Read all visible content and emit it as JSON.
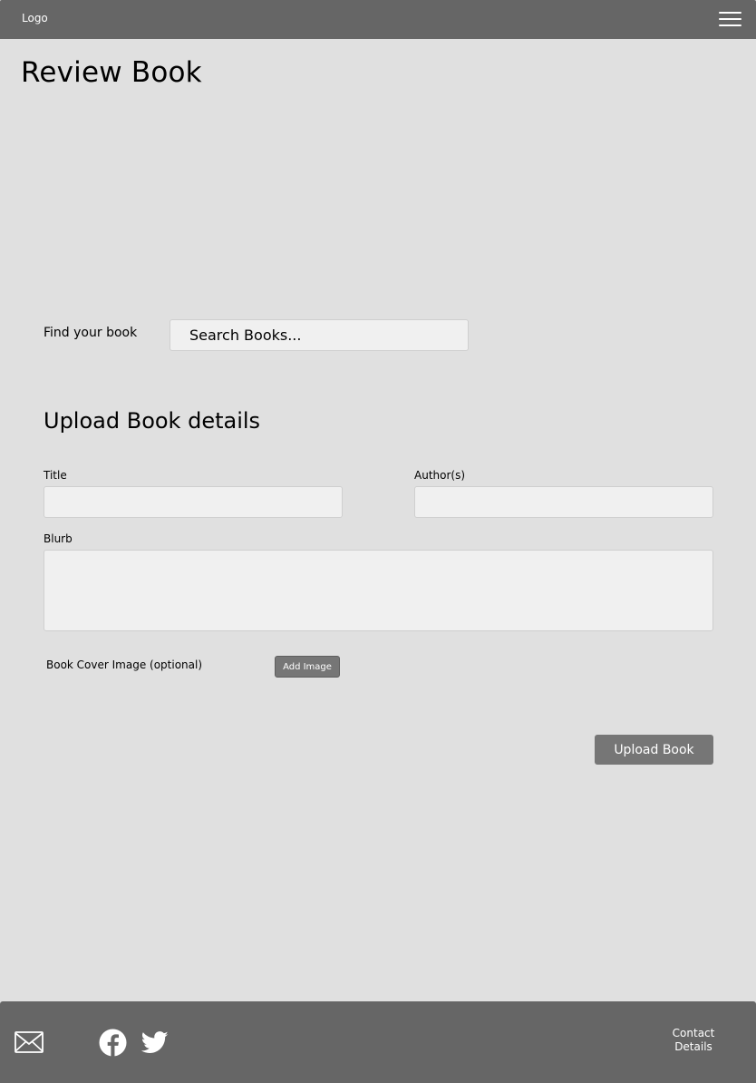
{
  "header": {
    "logo": "Logo",
    "menu_icon": "hamburger-menu-icon"
  },
  "page": {
    "title": "Review Book"
  },
  "find": {
    "label": "Find your book",
    "placeholder": "Search Books..."
  },
  "upload_form": {
    "title": "Upload Book details",
    "title_label": "Title",
    "author_label": "Author(s)",
    "blurb_label": "Blurb",
    "cover_label": "Book Cover Image (optional)",
    "add_image_label": "Add Image",
    "submit_label": "Upload Book"
  },
  "footer": {
    "icons": [
      "mail-icon",
      "facebook-icon",
      "twitter-icon"
    ],
    "contact_line1": "Contact",
    "contact_line2": "Details"
  },
  "colors": {
    "bar": "#666666",
    "background": "#e0e0e0",
    "input": "#f0f0f0",
    "button": "#767676"
  }
}
